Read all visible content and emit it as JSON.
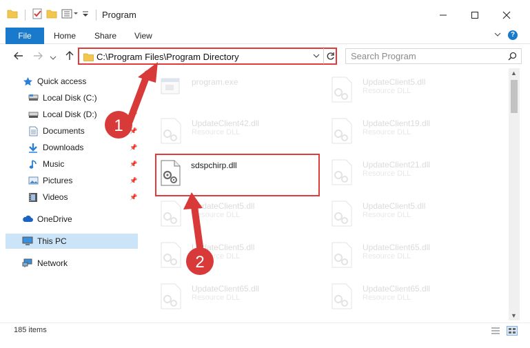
{
  "window": {
    "title": "Program"
  },
  "ribbon": {
    "tabs": [
      "File",
      "Home",
      "Share",
      "View"
    ],
    "help": "?"
  },
  "address": {
    "path": "C:\\Program Files\\Program Directory"
  },
  "search": {
    "placeholder": "Search Program"
  },
  "sidebar": {
    "items": [
      {
        "label": "Quick access",
        "icon": "star-icon"
      },
      {
        "label": "Local Disk (C:)",
        "icon": "drive-icon"
      },
      {
        "label": "Local Disk (D:)",
        "icon": "drive-icon"
      },
      {
        "label": "Documents",
        "icon": "documents-icon"
      },
      {
        "label": "Downloads",
        "icon": "download-icon"
      },
      {
        "label": "Music",
        "icon": "music-icon"
      },
      {
        "label": "Pictures",
        "icon": "pictures-icon"
      },
      {
        "label": "Videos",
        "icon": "videos-icon"
      },
      {
        "label": "OneDrive",
        "icon": "cloud-icon"
      },
      {
        "label": "This PC",
        "icon": "computer-icon"
      },
      {
        "label": "Network",
        "icon": "network-icon"
      }
    ]
  },
  "files": [
    {
      "name": "program.exe",
      "type": ""
    },
    {
      "name": "UpdateClient5.dll",
      "type": "Resource DLL"
    },
    {
      "name": "UpdateClient42.dll",
      "type": "Resource DLL"
    },
    {
      "name": "UpdateClient19.dll",
      "type": "Resource DLL"
    },
    {
      "name": "sdspchirp.dll",
      "type": ""
    },
    {
      "name": "UpdateClient21.dll",
      "type": "Resource DLL"
    },
    {
      "name": "UpdateClient5.dll",
      "type": "Resource DLL"
    },
    {
      "name": "UpdateClient5.dll",
      "type": "Resource DLL"
    },
    {
      "name": "UpdateClient5.dll",
      "type": "Resource DLL"
    },
    {
      "name": "UpdateClient65.dll",
      "type": "Resource DLL"
    },
    {
      "name": "UpdateClient65.dll",
      "type": "Resource DLL"
    },
    {
      "name": "UpdateClient65.dll",
      "type": "Resource DLL"
    }
  ],
  "status": {
    "count": "185 items"
  },
  "annotations": {
    "step1": "1",
    "step2": "2"
  },
  "colors": {
    "accent": "#1979ca",
    "highlight": "#e03a3a",
    "selected": "#cce4f7"
  }
}
